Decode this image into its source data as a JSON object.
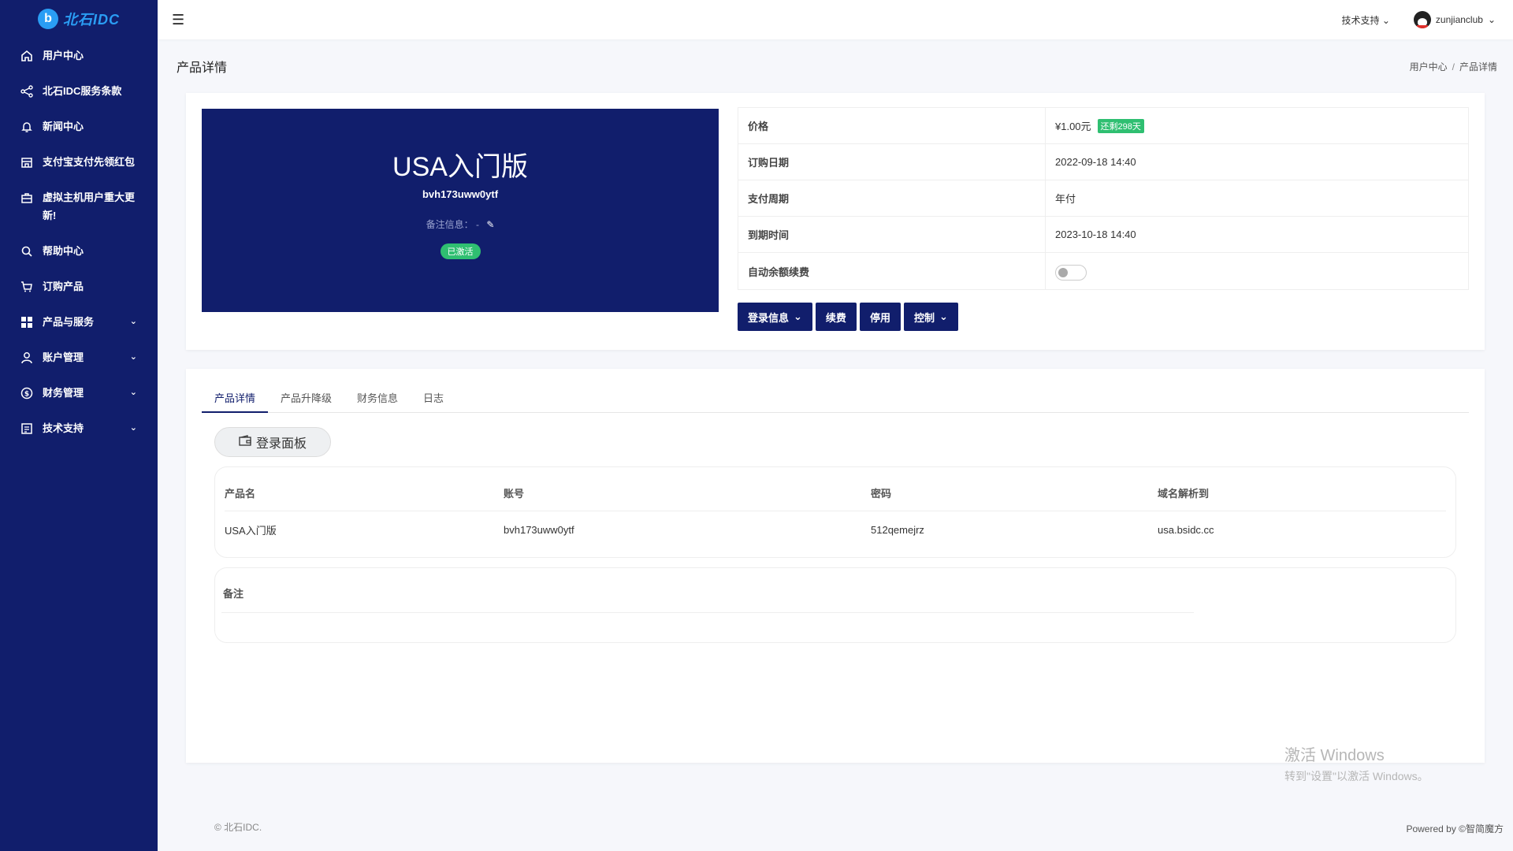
{
  "brand": {
    "mark": "b",
    "text": "北石IDC"
  },
  "sidebar": {
    "items": [
      {
        "label": "用户中心",
        "icon": "home-icon"
      },
      {
        "label": "北石IDC服务条款",
        "icon": "share-icon"
      },
      {
        "label": "新闻中心",
        "icon": "bell-icon"
      },
      {
        "label": "支付宝支付先领红包",
        "icon": "store-icon"
      },
      {
        "label": "虚拟主机用户重大更新!",
        "icon": "briefcase-icon"
      },
      {
        "label": "帮助中心",
        "icon": "search-icon"
      },
      {
        "label": "订购产品",
        "icon": "cart-icon"
      },
      {
        "label": "产品与服务",
        "icon": "grid-icon"
      },
      {
        "label": "账户管理",
        "icon": "user-icon"
      },
      {
        "label": "财务管理",
        "icon": "dollar-icon"
      },
      {
        "label": "技术支持",
        "icon": "ticket-icon"
      }
    ]
  },
  "topbar": {
    "support": "技术支持",
    "username": "zunjianclub"
  },
  "page": {
    "title": "产品详情",
    "breadcrumb": [
      "用户中心",
      "产品详情"
    ]
  },
  "product": {
    "name": "USA入门版",
    "username": "bvh173uww0ytf",
    "note_label": "备注信息：",
    "note_value": "-",
    "status": "已激活"
  },
  "info": {
    "price_label": "价格",
    "price": "¥1.00元",
    "remaining": "还剩298天",
    "order_date_label": "订购日期",
    "order_date": "2022-09-18 14:40",
    "cycle_label": "支付周期",
    "cycle": "年付",
    "expire_label": "到期时间",
    "expire": "2023-10-18 14:40",
    "auto_renew_label": "自动余额续费",
    "auto_renew": false
  },
  "actions": {
    "login_info": "登录信息",
    "renew": "续费",
    "disable": "停用",
    "control": "控制"
  },
  "tabs": [
    "产品详情",
    "产品升降级",
    "财务信息",
    "日志"
  ],
  "panel_button": "登录面板",
  "table": {
    "headers": [
      "产品名",
      "账号",
      "密码",
      "域名解析到"
    ],
    "row": [
      "USA入门版",
      "bvh173uww0ytf",
      "512qemejrz",
      "usa.bsidc.cc"
    ]
  },
  "note_section": "备注",
  "watermark": {
    "line1": "激活 Windows",
    "line2": "转到\"设置\"以激活 Windows。"
  },
  "footer": {
    "left": "© 北石IDC.",
    "right": "Powered by ©智简魔方"
  },
  "colors": {
    "primary": "#111e6c",
    "accent": "#2a9df4",
    "success": "#2fbf71"
  }
}
